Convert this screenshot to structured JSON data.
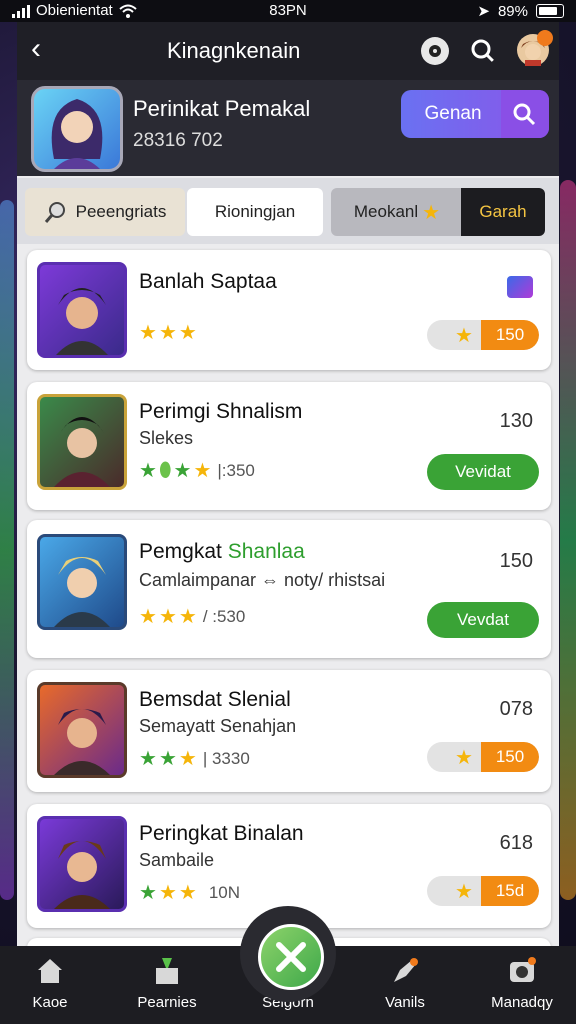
{
  "status_bar": {
    "carrier": "Obienientat",
    "time": "83PN",
    "battery": "89%"
  },
  "topbar": {
    "title": "Kinagnkenain"
  },
  "profile": {
    "name": "Perinikat Pemakal",
    "code": "28316 702",
    "search_label": "Genan"
  },
  "tabs": [
    {
      "label": "Peeengriats"
    },
    {
      "label": "Rioningjan"
    },
    {
      "label": "Meokanl"
    },
    {
      "label": "Garah"
    }
  ],
  "cards": [
    {
      "title": "Banlah Saptaa",
      "subtitle": "",
      "extra": "",
      "right_value": "",
      "action": "150",
      "action_type": "pill",
      "stars": 3
    },
    {
      "title": "Perimgi Shnalism",
      "subtitle": "Slekes",
      "extra": "|:350",
      "right_value": "130",
      "action": "Vevidat",
      "action_type": "green",
      "stars": 4
    },
    {
      "title": "Pemgkat",
      "title_highlight": "Shanlaa",
      "subtitle": "Camlaimpanar ⇔ noty/ rhistsai",
      "extra": "/ :530",
      "right_value": "150",
      "action": "Vevdat",
      "action_type": "green",
      "stars": 3
    },
    {
      "title": "Bemsdat Slenial",
      "subtitle": "Semayatt Senahjan",
      "extra": "| 3330",
      "right_value": "078",
      "action": "150",
      "action_type": "pill",
      "stars": 3
    },
    {
      "title": "Peringkat Binalan",
      "subtitle": "Sambaile",
      "extra": "10N",
      "right_value": "618",
      "action": "15d",
      "action_type": "pill",
      "stars": 3
    }
  ],
  "bottom_nav": [
    {
      "label": "Kaoe",
      "icon": "home-icon"
    },
    {
      "label": "Pearnies",
      "icon": "gift-icon"
    },
    {
      "label": "Selgorn",
      "icon": "sword-icon"
    },
    {
      "label": "Vanils",
      "icon": "rocket-icon"
    },
    {
      "label": "Manadqy",
      "icon": "camera-icon"
    }
  ],
  "colors": {
    "accent": "#7a63f0",
    "orange": "#f28b12",
    "green": "#3aa336",
    "gold": "#f5b50a"
  }
}
